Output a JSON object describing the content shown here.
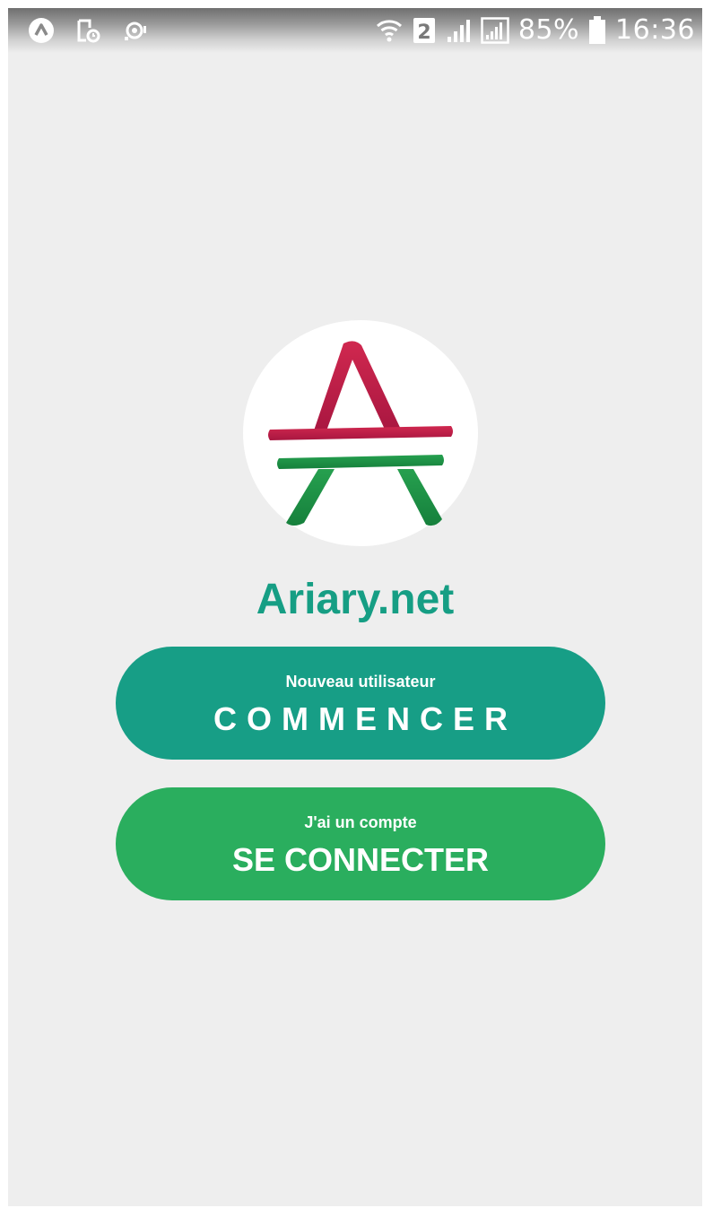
{
  "status_bar": {
    "battery_percent": "85%",
    "time": "16:36",
    "sim_slot": "2",
    "icons": [
      "app-a-icon",
      "screenshot-icon",
      "voicemail-icon",
      "wifi-icon",
      "sim-2-icon",
      "signal-icon",
      "signal-icon-2",
      "battery-icon"
    ]
  },
  "logo": {
    "top_color": "#c8214f",
    "bottom_color": "#1f9748"
  },
  "brand": {
    "title": "Ariary.net",
    "color": "#169e84"
  },
  "start_button": {
    "subtitle": "Nouveau utilisateur",
    "label": "COMMENCER",
    "color": "#179e86"
  },
  "login_button": {
    "subtitle": "J'ai un compte",
    "label": "SE CONNECTER",
    "color": "#2aae5e"
  }
}
